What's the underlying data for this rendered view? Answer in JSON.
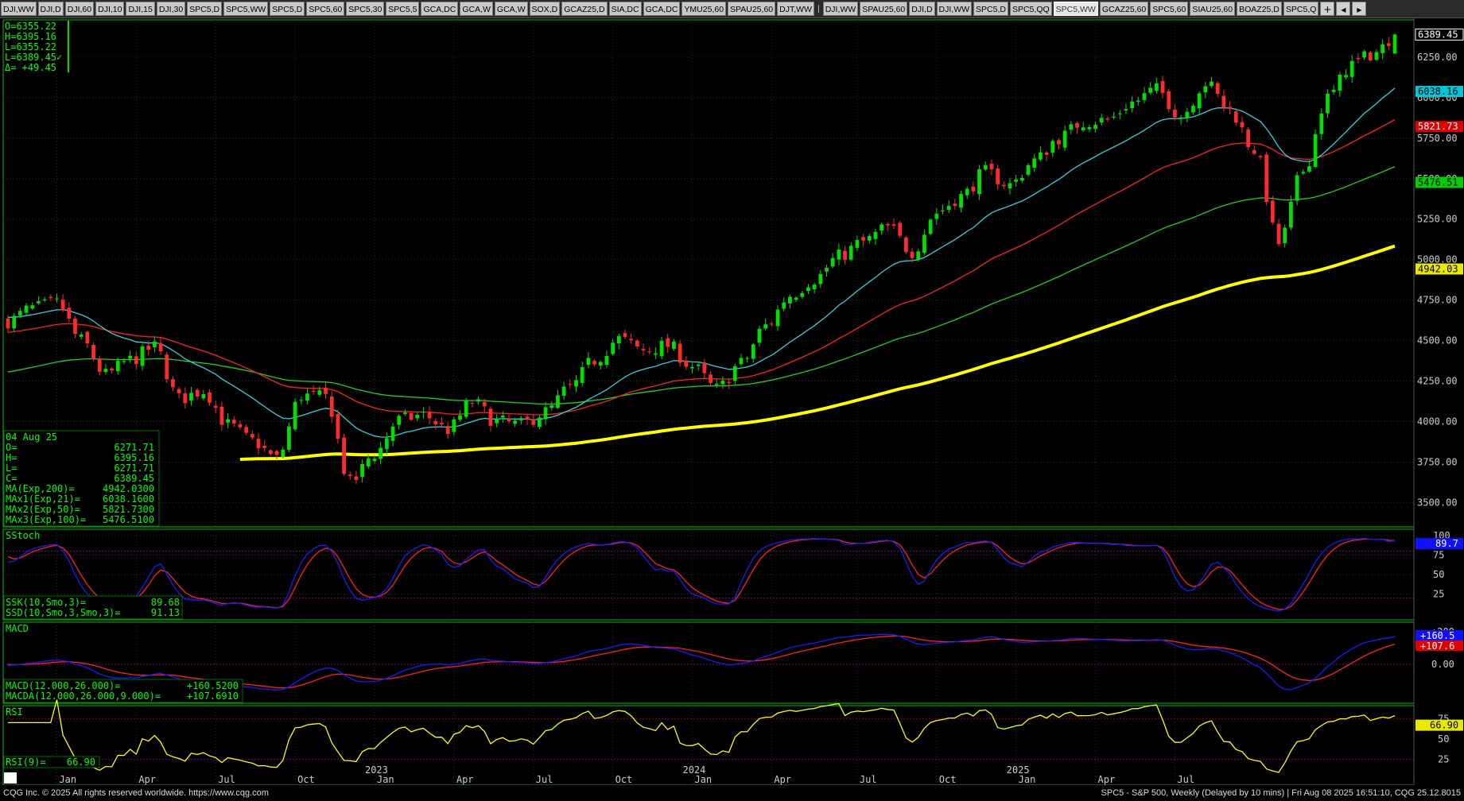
{
  "tabs": [
    "DJI,WW",
    "DJI,D",
    "DJI,60",
    "DJI,10",
    "DJI,15",
    "DJI,30",
    "SPC5,D",
    "SPC5,WW",
    "SPC5,D",
    "SPC5,60",
    "SPC5,30",
    "SPC5,5",
    "GCA,DC",
    "GCA,W",
    "GCA,W",
    "SOX,D",
    "GCAZ25,D",
    "SIA,DC",
    "GCA,DC",
    "YMU25,60",
    "SPAU25,60",
    "DJT,WW",
    "|",
    "DJI,WW",
    "SPAU25,60",
    "DJI,D",
    "DJI,WW",
    "SPC5,D",
    "SPC5,QQ",
    "SPC5,WW",
    "GCAZ25,60",
    "SPC5,60",
    "SIAU25,60",
    "BOAZ25,D",
    "SPC5,Q"
  ],
  "active_tab": 29,
  "tab_controls": [
    "+",
    "◂",
    "▸"
  ],
  "colors": {
    "up": "#00e000",
    "down": "#ff2a2a",
    "ma21": "#30d0e0",
    "ma50": "#ff2020",
    "ma100": "#20d020",
    "ma200": "#ffff00",
    "stochK": "#1a1aff",
    "stochD": "#ff2020",
    "rsi": "#ffff00",
    "grid": "#2a2a2a",
    "panel_border": "#00c000"
  },
  "ohlc_box": {
    "lines": [
      "O=6355.22",
      "H=6395.16",
      "L=6355.22",
      "L=6389.45✓",
      "Δ= +49.45"
    ]
  },
  "info_box": {
    "date": "04 Aug 25",
    "rows": [
      {
        "label": "O=",
        "value": "6271.71"
      },
      {
        "label": "H=",
        "value": "6395.16"
      },
      {
        "label": "L=",
        "value": "6271.71"
      },
      {
        "label": "C=",
        "value": "6389.45"
      },
      {
        "label": "MA(Exp,200)=",
        "value": "4942.0300"
      },
      {
        "label": "MAx1(Exp,21)=",
        "value": "6038.1600"
      },
      {
        "label": "MAx2(Exp,50)=",
        "value": "5821.7300"
      },
      {
        "label": "MAx3(Exp,100)=",
        "value": "5476.5100"
      }
    ]
  },
  "price_axis": {
    "ticks": [
      "6250.00",
      "6000.00",
      "5750.00",
      "5500.00",
      "5250.00",
      "5000.00",
      "4750.00",
      "4500.00",
      "4250.00",
      "4000.00",
      "3750.00",
      "3500.00"
    ],
    "tick_values": [
      6250,
      6000,
      5750,
      5500,
      5250,
      5000,
      4750,
      4500,
      4250,
      4000,
      3750,
      3500
    ]
  },
  "price_labels": [
    {
      "value": 6389.45,
      "text": "6389.45",
      "bg": "#000",
      "fg": "#fff",
      "border": "#fff"
    },
    {
      "value": 6038.16,
      "text": "6038.16",
      "bg": "#00c8d8",
      "fg": "#000"
    },
    {
      "value": 5821.73,
      "text": "5821.73",
      "bg": "#e00000",
      "fg": "#fff"
    },
    {
      "value": 5476.51,
      "text": "5476.51",
      "bg": "#00d000",
      "fg": "#000"
    },
    {
      "value": 4942.03,
      "text": "4942.03",
      "bg": "#e8e800",
      "fg": "#000"
    }
  ],
  "stoch": {
    "title": "SStoch",
    "ticks": [
      "100",
      "75",
      "50",
      "25"
    ],
    "tick_values": [
      100,
      75,
      50,
      25
    ],
    "last": "89.7",
    "rows": [
      {
        "label": "SSK(10,Smo,3)=",
        "value": "89.68"
      },
      {
        "label": "SSD(10,Smo,3,Smo,3)=",
        "value": "91.13"
      }
    ]
  },
  "macd": {
    "title": "MACD",
    "ticks": [
      "+200",
      "0.00"
    ],
    "tick_values": [
      200,
      0
    ],
    "label_blue": "+160.5",
    "label_red": "+107.6",
    "rows": [
      {
        "label": "MACD(12.000,26.000)=",
        "value": "+160.5200"
      },
      {
        "label": "MACDA(12.000,26.000,9.000)=",
        "value": "+107.6910"
      }
    ]
  },
  "rsi": {
    "title": "RSI",
    "ticks": [
      "75",
      "50",
      "25"
    ],
    "tick_values": [
      75,
      50,
      25
    ],
    "last": "66.90",
    "row": {
      "label": "RSI(9)=",
      "value": "66.90"
    }
  },
  "x_axis": {
    "months": [
      "Jan",
      "Apr",
      "Jul",
      "Oct",
      "Jan",
      "Apr",
      "Jul",
      "Oct",
      "Jan",
      "Apr",
      "Jul",
      "Oct",
      "Jan",
      "Apr",
      "Jul"
    ],
    "years": [
      {
        "label": "2023",
        "index": 4
      },
      {
        "label": "2024",
        "index": 8
      },
      {
        "label": "2025",
        "index": 12
      }
    ]
  },
  "footer": {
    "left": "CQG Inc. © 2025 All rights reserved worldwide. https://www.cqg.com",
    "right": "SPC5 - S&P 500, Weekly (Delayed by 10 mins) | Fri Aug 08 2025 16:51:10, CQG 25.12.8015"
  },
  "chart_data": {
    "type": "candlestick",
    "interval": "weekly",
    "anchors": [
      [
        0,
        4620
      ],
      [
        4,
        4700
      ],
      [
        8,
        4730
      ],
      [
        12,
        4500
      ],
      [
        16,
        4290
      ],
      [
        20,
        4380
      ],
      [
        24,
        4460
      ],
      [
        28,
        4140
      ],
      [
        32,
        4190
      ],
      [
        36,
        3980
      ],
      [
        40,
        3880
      ],
      [
        44,
        3770
      ],
      [
        48,
        4160
      ],
      [
        52,
        4150
      ],
      [
        56,
        3620
      ],
      [
        60,
        3800
      ],
      [
        64,
        4010
      ],
      [
        68,
        4040
      ],
      [
        72,
        3950
      ],
      [
        76,
        4120
      ],
      [
        80,
        4000
      ],
      [
        84,
        3980
      ],
      [
        88,
        4060
      ],
      [
        92,
        4210
      ],
      [
        96,
        4380
      ],
      [
        100,
        4510
      ],
      [
        104,
        4440
      ],
      [
        108,
        4470
      ],
      [
        112,
        4340
      ],
      [
        116,
        4200
      ],
      [
        120,
        4360
      ],
      [
        124,
        4590
      ],
      [
        128,
        4780
      ],
      [
        132,
        4880
      ],
      [
        136,
        5020
      ],
      [
        140,
        5110
      ],
      [
        144,
        5200
      ],
      [
        148,
        5050
      ],
      [
        152,
        5290
      ],
      [
        156,
        5390
      ],
      [
        160,
        5540
      ],
      [
        164,
        5460
      ],
      [
        168,
        5610
      ],
      [
        172,
        5750
      ],
      [
        176,
        5850
      ],
      [
        180,
        5860
      ],
      [
        184,
        5970
      ],
      [
        188,
        6050
      ],
      [
        192,
        5890
      ],
      [
        196,
        6090
      ],
      [
        200,
        5920
      ],
      [
        204,
        5680
      ],
      [
        208,
        5100
      ],
      [
        212,
        5550
      ],
      [
        216,
        6000
      ],
      [
        220,
        6210
      ],
      [
        224,
        6280
      ],
      [
        227,
        6389
      ]
    ]
  }
}
